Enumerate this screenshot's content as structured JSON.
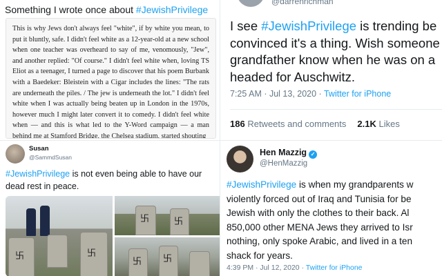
{
  "panel_essay": {
    "header_prefix": "Something I wrote once about ",
    "hashtag": "#JewishPrivilege",
    "body": "This is why Jews don't always feel \"white\", if by white you mean, to put it bluntly, safe. I didn't feel white as a 12-year-old at a new school when one teacher was overheard to say of me, venomously, \"Jew\", and another replied: \"Of course.\" I didn't feel white when, loving TS Eliot as a teenager, I turned a page to discover that his poem Burbank with a Baedeker: Bleistein with a Cigar includes the lines: \"The rats are underneath the piles. / The jew is underneath the lot.\" I didn't feel white when I was actually being beaten up in London in the 1970s, however much I might later convert it to comedy. I didn't feel white when — and this is what led to the Y-Word campaign — a man behind me at Stamford Bridge, the Chelsea stadium, started shouting"
  },
  "panel_tweet_darren": {
    "handle": "@darrenrichman",
    "line1_hashtag": "#JewishPrivilege",
    "line1_rest": " is trending be",
    "line1_prefix": "I see ",
    "line2": "convinced it's a thing. Wish someone",
    "line3": "grandfather know when he was on a",
    "line4": "headed for Auschwitz.",
    "meta": "7:25 AM · Jul 13, 2020 · ",
    "source": "Twitter for iPhone",
    "retweets_count": "186",
    "retweets_label": "Retweets and comments",
    "likes_count": "2.1K",
    "likes_label": "Likes"
  },
  "panel_tweet_susan": {
    "name": "Susan",
    "handle": "@SammdSusan",
    "hashtag": "#JewishPrivilege",
    "rest": " is not even being able to have our dead rest in peace."
  },
  "panel_tweet_hen": {
    "name": "Hen Mazzig",
    "handle": "@HenMazzig",
    "line1_hashtag": "#JewishPrivilege",
    "line1_rest": " is when my grandparents w",
    "line2": "violently forced out of Iraq and Tunisia for be",
    "line3": "Jewish with only the clothes to their back. Al",
    "line4": "850,000 other MENA Jews they arrived to Isr",
    "line5": "nothing, only spoke Arabic, and lived in a ten",
    "line6": "shack for years.",
    "meta": "4:39 PM · Jul 12, 2020 · ",
    "source": "Twitter for iPhone"
  },
  "icons": {
    "verified": "verified-badge-icon",
    "checkmark": "✓",
    "swastika": "卐"
  },
  "colors": {
    "hashtag": "#1da1f2",
    "text": "#14171a",
    "muted": "#657786"
  }
}
